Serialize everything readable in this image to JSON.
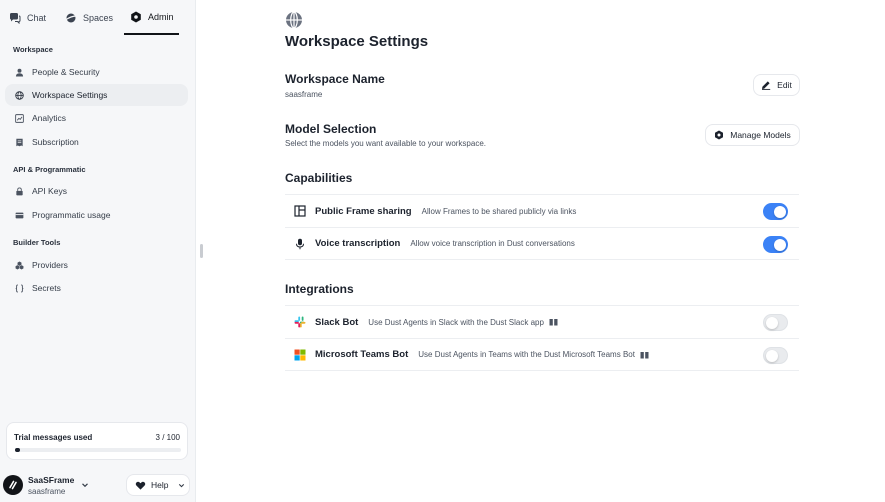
{
  "topnav": {
    "tabs": [
      {
        "label": "Chat",
        "icon": "chat-icon"
      },
      {
        "label": "Spaces",
        "icon": "planet-icon"
      },
      {
        "label": "Admin",
        "icon": "hexagon-icon",
        "active": true
      }
    ]
  },
  "sidebar": {
    "sections": [
      {
        "label": "Workspace"
      },
      {
        "label": "API & Programmatic"
      },
      {
        "label": "Builder Tools"
      }
    ],
    "items": [
      {
        "label": "People & Security",
        "icon": "user-icon"
      },
      {
        "label": "Workspace Settings",
        "icon": "globe-icon",
        "active": true
      },
      {
        "label": "Analytics",
        "icon": "chart-icon"
      },
      {
        "label": "Subscription",
        "icon": "receipt-icon"
      },
      {
        "label": "API Keys",
        "icon": "lock-icon"
      },
      {
        "label": "Programmatic usage",
        "icon": "card-icon"
      },
      {
        "label": "Providers",
        "icon": "cubes-icon"
      },
      {
        "label": "Secrets",
        "icon": "braces-icon"
      }
    ],
    "trial": {
      "label": "Trial messages used",
      "count": "3 / 100",
      "progress": 0.03
    },
    "account": {
      "name": "SaaSFrame",
      "workspace": "saasframe"
    },
    "help_label": "Help"
  },
  "main": {
    "title": "Workspace Settings",
    "name_section": {
      "title": "Workspace Name",
      "value": "saasframe",
      "edit_label": "Edit"
    },
    "model_section": {
      "title": "Model Selection",
      "desc": "Select the models you want available to your workspace.",
      "button_label": "Manage Models"
    },
    "capabilities": {
      "title": "Capabilities",
      "rows": [
        {
          "name": "Public Frame sharing",
          "desc": "Allow Frames to be shared publicly via links",
          "enabled": true,
          "icon": "frame-icon"
        },
        {
          "name": "Voice transcription",
          "desc": "Allow voice transcription in Dust conversations",
          "enabled": true,
          "icon": "microphone-icon"
        }
      ]
    },
    "integrations": {
      "title": "Integrations",
      "rows": [
        {
          "name": "Slack Bot",
          "desc": "Use Dust Agents in Slack with the Dust Slack app",
          "enabled": false,
          "icon": "slack-icon"
        },
        {
          "name": "Microsoft Teams Bot",
          "desc": "Use Dust Agents in Teams with the Dust Microsoft Teams Bot",
          "enabled": false,
          "icon": "microsoft-icon"
        }
      ]
    }
  },
  "colors": {
    "accent": "#3b82f6",
    "sidebar_bg": "#f6f7f9",
    "text": "#1c222d"
  }
}
